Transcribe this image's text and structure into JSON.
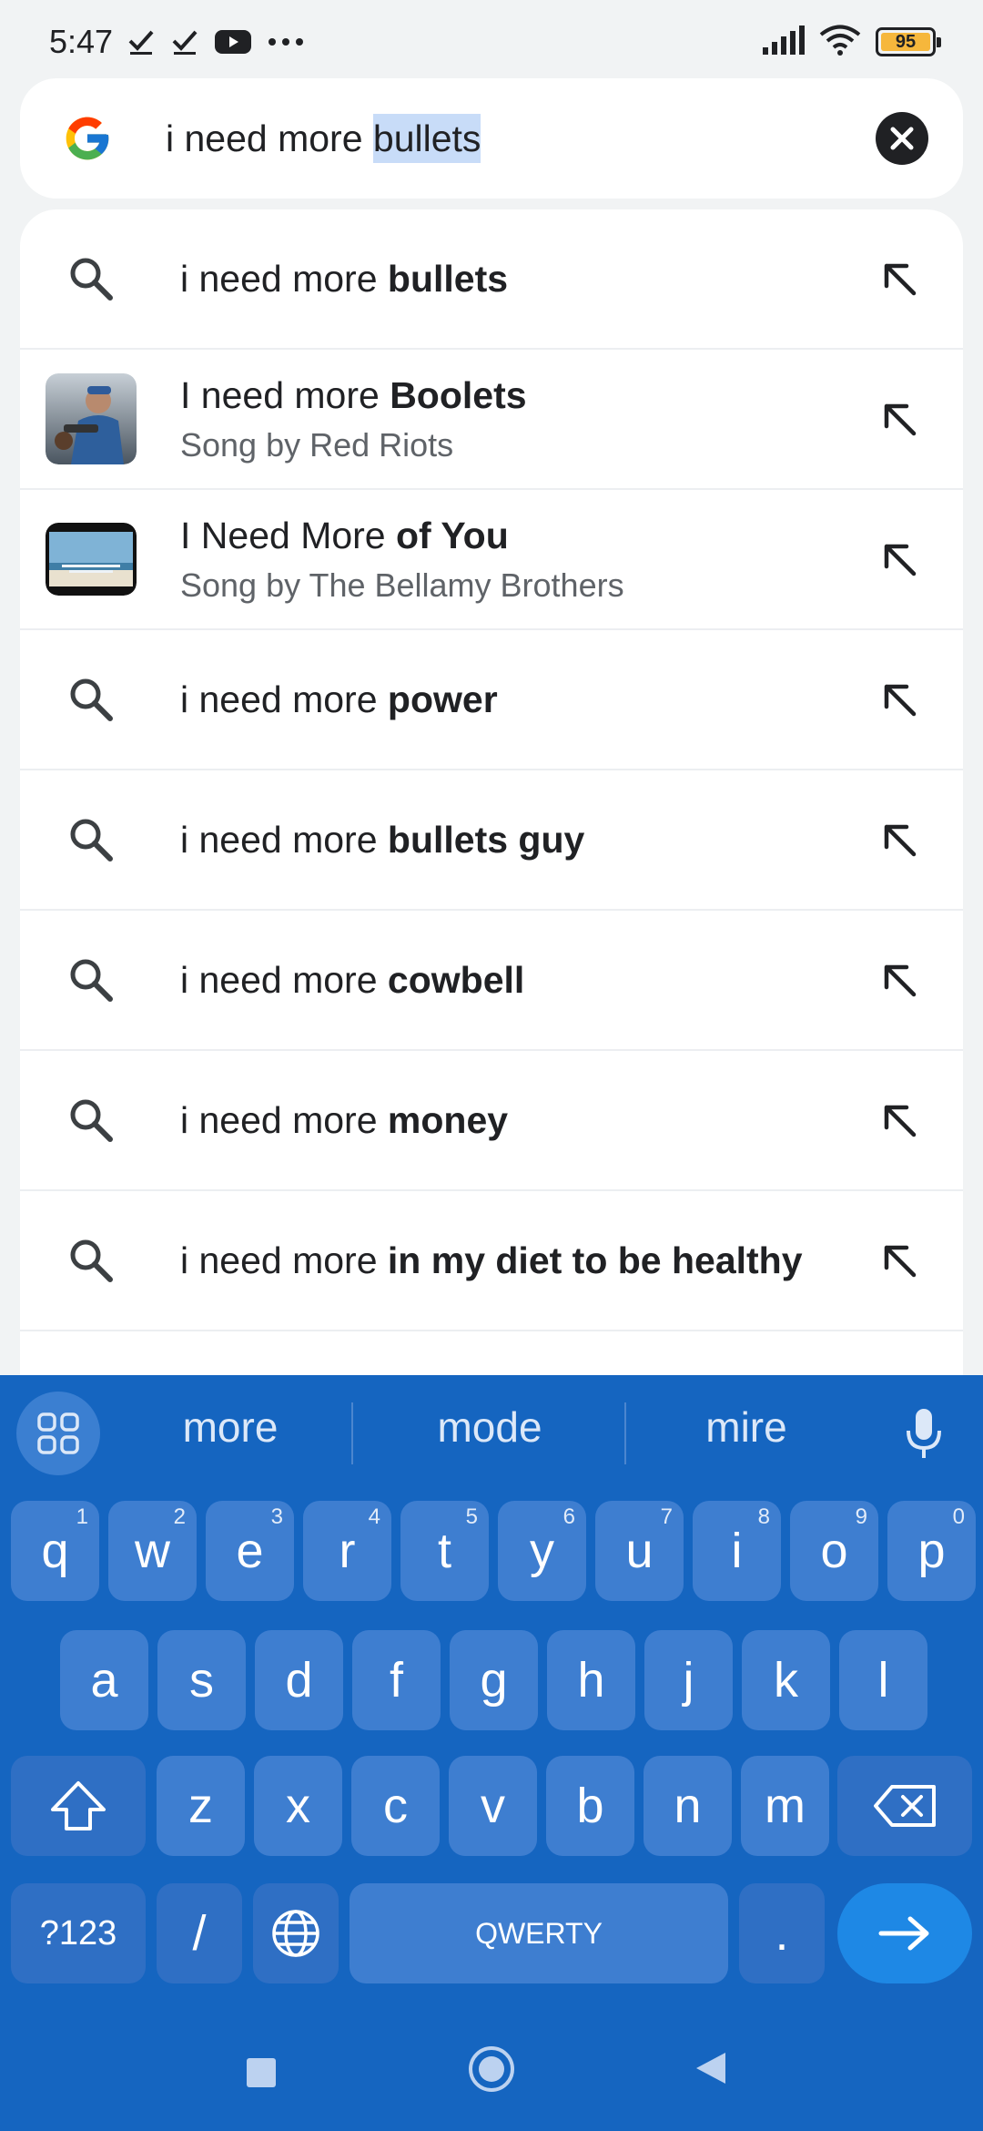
{
  "status_bar": {
    "time": "5:47",
    "battery": "95",
    "icons": [
      "check-icon",
      "check-icon",
      "youtube-icon",
      "more-dots-icon",
      "signal-icon",
      "wifi-icon",
      "battery-icon"
    ]
  },
  "search": {
    "query_prefix": "i need more ",
    "query_selected": "bullets"
  },
  "suggestions": [
    {
      "type": "search",
      "normal": "i need more ",
      "bold": "bullets",
      "sub": ""
    },
    {
      "type": "song",
      "normal": "I need more ",
      "bold": "Boolets",
      "sub": "Song by Red Riots"
    },
    {
      "type": "song",
      "normal": "I Need More ",
      "bold": "of You",
      "sub": "Song by The Bellamy Brothers"
    },
    {
      "type": "search",
      "normal": "i need more ",
      "bold": "power",
      "sub": ""
    },
    {
      "type": "search",
      "normal": "i need more ",
      "bold": "bullets guy",
      "sub": ""
    },
    {
      "type": "search",
      "normal": "i need more ",
      "bold": "cowbell",
      "sub": ""
    },
    {
      "type": "search",
      "normal": "i need more ",
      "bold": "money",
      "sub": ""
    },
    {
      "type": "search",
      "normal": "i need more ",
      "bold": "in my diet to be healthy",
      "sub": ""
    }
  ],
  "keyboard": {
    "suggestions": [
      "more",
      "mode",
      "mire"
    ],
    "row1": [
      {
        "k": "q",
        "h": "1"
      },
      {
        "k": "w",
        "h": "2"
      },
      {
        "k": "e",
        "h": "3"
      },
      {
        "k": "r",
        "h": "4"
      },
      {
        "k": "t",
        "h": "5"
      },
      {
        "k": "y",
        "h": "6"
      },
      {
        "k": "u",
        "h": "7"
      },
      {
        "k": "i",
        "h": "8"
      },
      {
        "k": "o",
        "h": "9"
      },
      {
        "k": "p",
        "h": "0"
      }
    ],
    "row2": [
      "a",
      "s",
      "d",
      "f",
      "g",
      "h",
      "j",
      "k",
      "l"
    ],
    "row3": [
      "z",
      "x",
      "c",
      "v",
      "b",
      "n",
      "m"
    ],
    "symbols_label": "?123",
    "slash_label": "/",
    "space_label": "QWERTY",
    "period_label": "."
  },
  "colors": {
    "keyboard_bg": "#1565c0",
    "key_bg": "#3e7ed0",
    "enter_bg": "#1e88e5",
    "selection": "#c8dcf8"
  }
}
